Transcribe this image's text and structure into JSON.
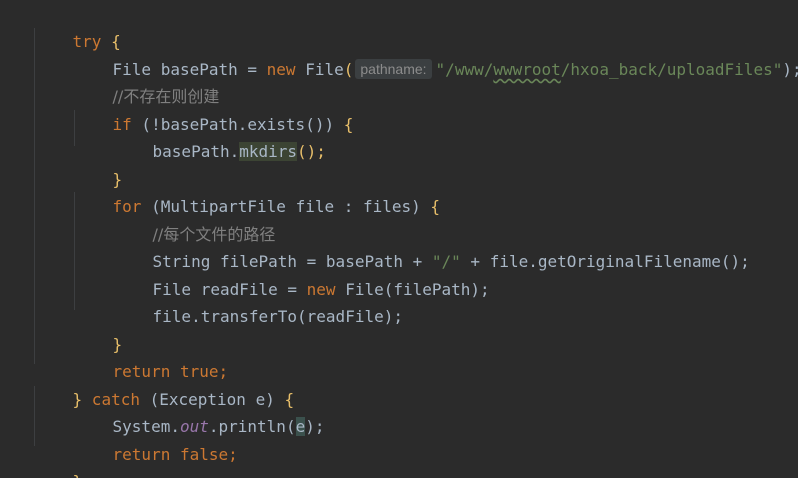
{
  "editor": {
    "lines": {
      "l1": {
        "kw": "try",
        "brace": " {"
      },
      "l2": {
        "a": "File basePath = ",
        "kw": "new",
        "b": " File",
        "paren": "(",
        "hint": "pathname:",
        "str1": "\"/www/",
        "str2": "wwwroot",
        "str3": "/hxoa_back/uploadFiles\"",
        "end": ");"
      },
      "l3": {
        "cmt": "//不存在则创建"
      },
      "l4": {
        "kw": "if",
        "a": " (!basePath.exists()) ",
        "brace": "{"
      },
      "l5": {
        "a": "basePath.",
        "b": "mkdirs",
        "c": "();"
      },
      "l6": {
        "brace": "}"
      },
      "l7": {
        "kw": "for",
        "a": " (MultipartFile file : files) ",
        "brace": "{"
      },
      "l8": {
        "cmt": "//每个文件的路径"
      },
      "l9": {
        "a": "String filePath = basePath + ",
        "str": "\"/\"",
        "b": " + file.getOriginalFilename();"
      },
      "l10": {
        "a": "File readFile = ",
        "kw": "new",
        "b": " File(filePath);"
      },
      "l11": {
        "a": "file.transferTo(readFile);"
      },
      "l12": {
        "brace": "}"
      },
      "l13": {
        "kw": "return",
        "kw2": " true",
        "end": ";"
      },
      "l14": {
        "brace": "}",
        "kw": " catch",
        "a": " (Exception e) ",
        "brace2": "{"
      },
      "l15": {
        "a": "System.",
        "fld": "out",
        "b": ".println(",
        "e": "e",
        "c": ");"
      },
      "l16": {
        "kw": "return",
        "kw2": " false",
        "end": ";"
      },
      "l17": {
        "brace": "}"
      }
    }
  }
}
